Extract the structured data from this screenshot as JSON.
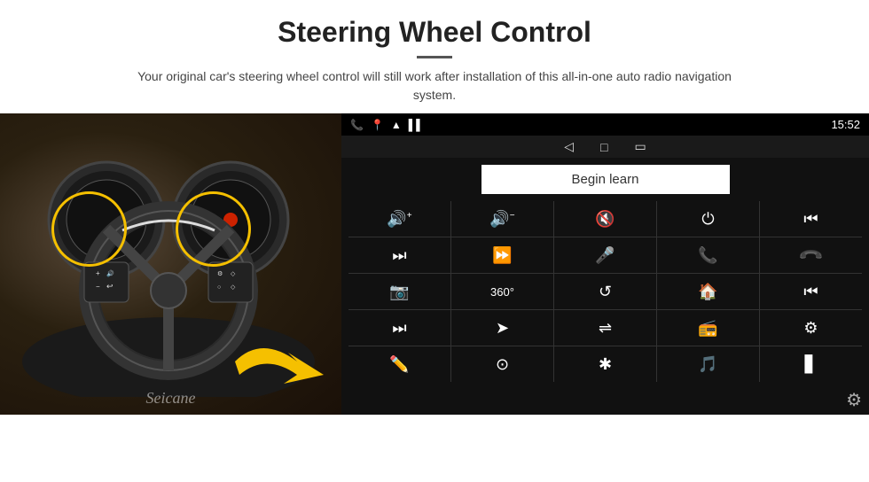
{
  "header": {
    "title": "Steering Wheel Control",
    "subtitle": "Your original car's steering wheel control will still work after installation of this all-in-one auto radio navigation system."
  },
  "status_bar": {
    "time": "15:52",
    "nav_icons": [
      "◁",
      "□",
      "○"
    ]
  },
  "begin_learn": {
    "label": "Begin learn"
  },
  "grid_icons": [
    "🔊+",
    "🔊−",
    "🔇",
    "⏻",
    "⏮",
    "⏭",
    "⏩",
    "🎤",
    "📞",
    "↩",
    "📷",
    "🔍",
    "↺",
    "🏠",
    "⏮",
    "⏭",
    "➤",
    "⇌",
    "📻",
    "⚙",
    "✏",
    "⊙",
    "✱",
    "🎵",
    "▋"
  ],
  "seicane_label": "Seicane",
  "settings_icon": "⚙"
}
